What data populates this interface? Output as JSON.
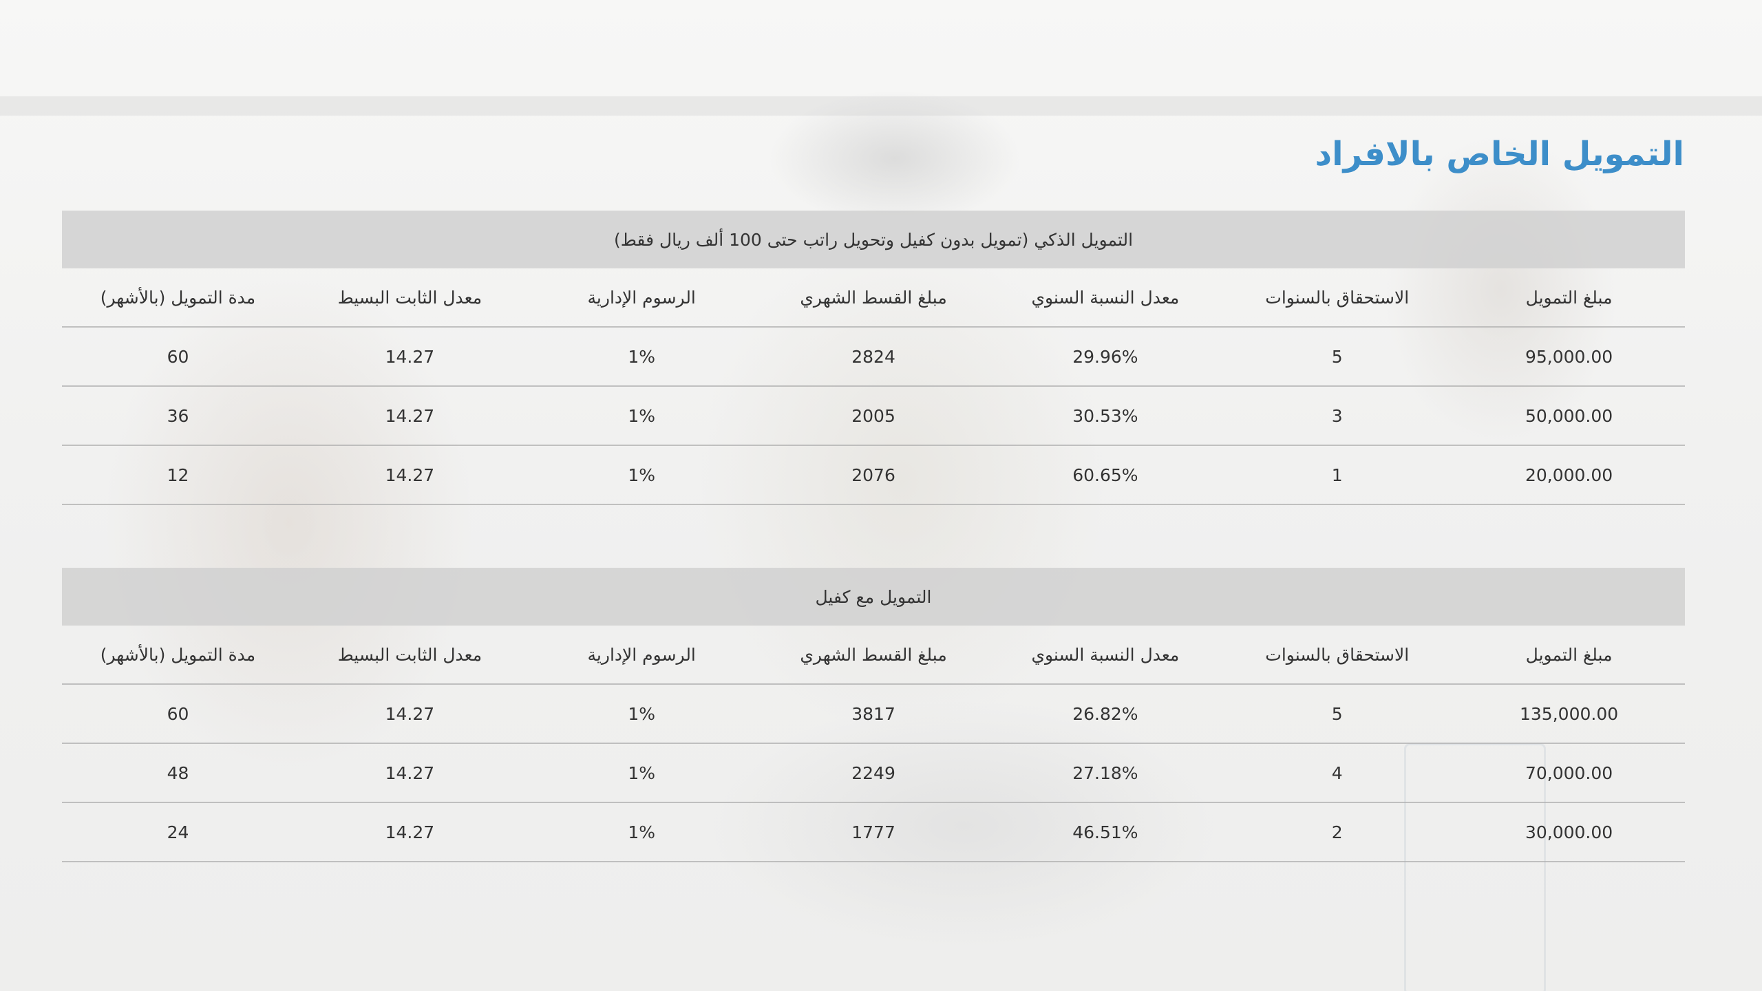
{
  "page": {
    "title": "التمويل الخاص بالافراد",
    "accent_color": "#3d8ec9",
    "caption_background": "#d0d0d0"
  },
  "columns": [
    "مبلغ التمويل",
    "الاستحقاق بالسنوات",
    "معدل النسبة السنوي",
    "مبلغ القسط الشهري",
    "الرسوم الإدارية",
    "معدل الثابت البسيط",
    "مدة التمويل (بالأشهر)"
  ],
  "tables": [
    {
      "caption": "التمويل الذكي (تمويل بدون كفيل وتحويل راتب حتى 100 ألف ريال فقط)",
      "rows": [
        [
          "95,000.00",
          "5",
          "29.96%",
          "2824",
          "1%",
          "14.27",
          "60"
        ],
        [
          "50,000.00",
          "3",
          "30.53%",
          "2005",
          "1%",
          "14.27",
          "36"
        ],
        [
          "20,000.00",
          "1",
          "60.65%",
          "2076",
          "1%",
          "14.27",
          "12"
        ]
      ]
    },
    {
      "caption": "التمويل مع كفيل",
      "rows": [
        [
          "135,000.00",
          "5",
          "26.82%",
          "3817",
          "1%",
          "14.27",
          "60"
        ],
        [
          "70,000.00",
          "4",
          "27.18%",
          "2249",
          "1%",
          "14.27",
          "48"
        ],
        [
          "30,000.00",
          "2",
          "46.51%",
          "1777",
          "1%",
          "14.27",
          "24"
        ]
      ]
    }
  ]
}
